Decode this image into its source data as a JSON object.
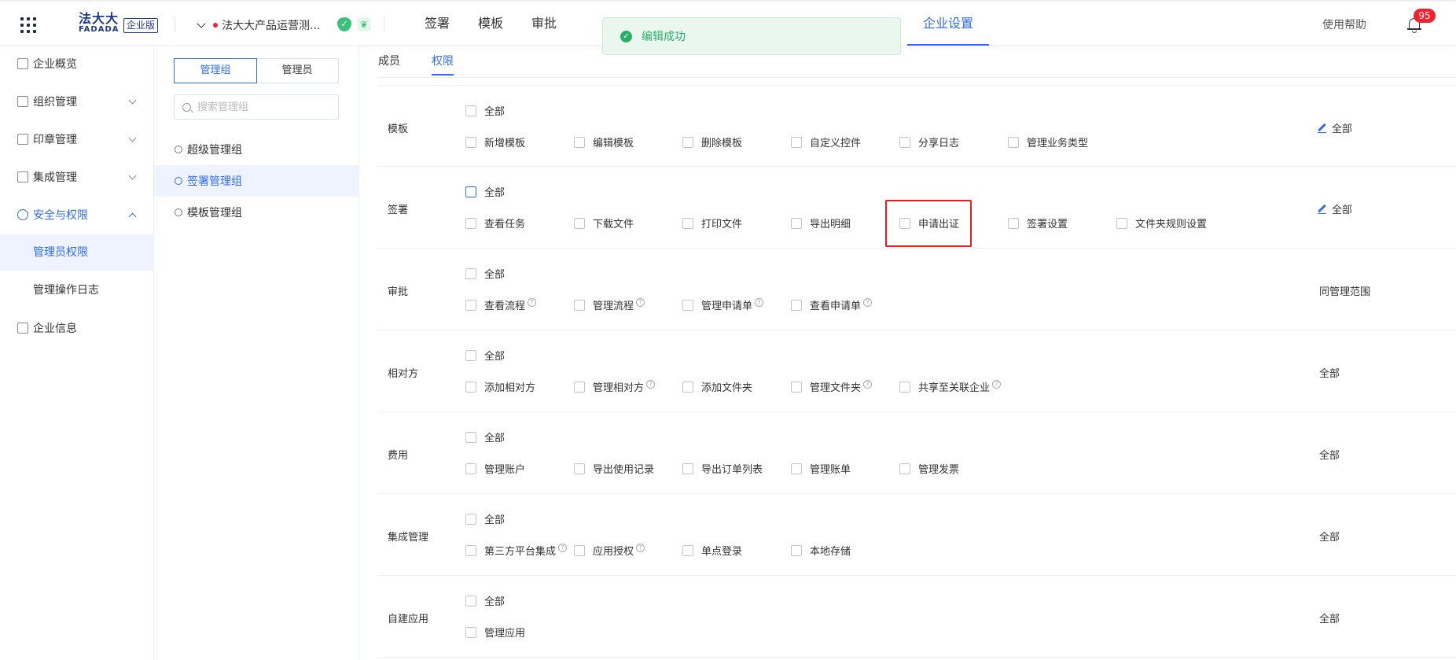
{
  "header": {
    "logo_cn": "法大大",
    "logo_en": "FADADA",
    "edition": "企业版",
    "company_name": "法大大产品运营测...",
    "nav": [
      {
        "label": "签署"
      },
      {
        "label": "模板"
      },
      {
        "label": "审批"
      }
    ],
    "nav_active": "企业设置",
    "help": "使用帮助",
    "notifications": "95",
    "icons": {
      "apps": "apps-grid-icon",
      "shield": "verified-shield-icon",
      "leaf": "eco-leaf-icon",
      "bell": "bell-icon"
    }
  },
  "toast": {
    "text": "编辑成功",
    "icon": "check-circle-icon"
  },
  "sidebar": {
    "items": [
      {
        "label": "企业概览"
      },
      {
        "label": "组织管理"
      },
      {
        "label": "印章管理"
      },
      {
        "label": "集成管理"
      },
      {
        "label": "安全与权限"
      },
      {
        "label": "管理员权限"
      },
      {
        "label": "管理操作日志"
      },
      {
        "label": "企业信息"
      }
    ]
  },
  "groups": {
    "tabs": [
      {
        "label": "管理组"
      },
      {
        "label": "管理员"
      }
    ],
    "search_placeholder": "搜索管理组",
    "items": [
      {
        "label": "超级管理组"
      },
      {
        "label": "签署管理组"
      },
      {
        "label": "模板管理组"
      }
    ]
  },
  "main": {
    "tabs": [
      {
        "label": "成员"
      },
      {
        "label": "权限"
      }
    ],
    "all_label": "全部",
    "rows": [
      {
        "label": "模板",
        "scope": "全部",
        "options": [
          "新增模板",
          "编辑模板",
          "删除模板",
          "自定义控件",
          "分享日志",
          "管理业务类型"
        ]
      },
      {
        "label": "签署",
        "scope": "全部",
        "options": [
          "查看任务",
          "下载文件",
          "打印文件",
          "导出明细",
          "申请出证",
          "签署设置",
          "文件夹规则设置"
        ]
      },
      {
        "label": "审批",
        "scope": "同管理范围",
        "options": [
          "查看流程",
          "管理流程",
          "管理申请单",
          "查看申请单"
        ]
      },
      {
        "label": "相对方",
        "scope": "全部",
        "options": [
          "添加相对方",
          "管理相对方",
          "添加文件夹",
          "管理文件夹",
          "共享至关联企业"
        ]
      },
      {
        "label": "费用",
        "scope": "全部",
        "options": [
          "管理账户",
          "导出使用记录",
          "导出订单列表",
          "管理账单",
          "管理发票"
        ]
      },
      {
        "label": "集成管理",
        "scope": "全部",
        "options": [
          "第三方平台集成",
          "应用授权",
          "单点登录",
          "本地存储"
        ]
      },
      {
        "label": "自建应用",
        "scope": "全部",
        "options": [
          "管理应用"
        ]
      }
    ]
  },
  "colors": {
    "accent": "#2f6bff",
    "success": "#28b06a",
    "danger": "#f5222d",
    "highlight": "#e02020"
  }
}
